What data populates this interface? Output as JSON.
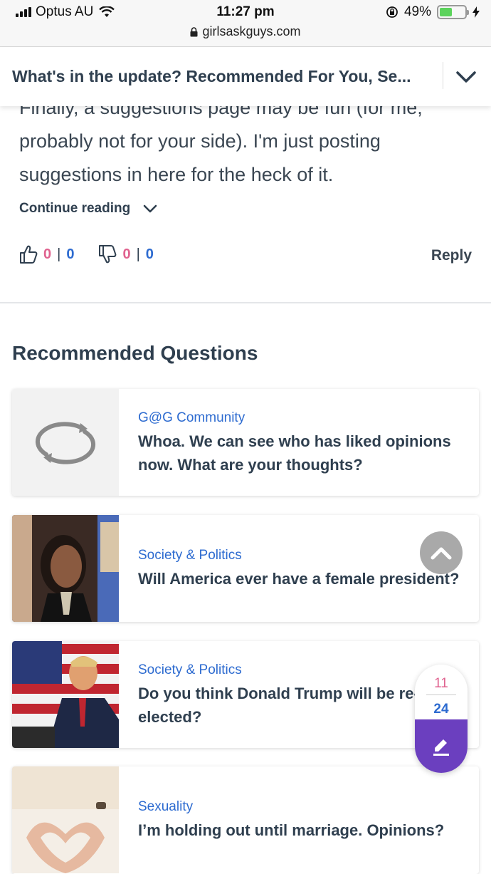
{
  "status_bar": {
    "carrier": "Optus AU",
    "time": "11:27 pm",
    "battery_percent": "49%",
    "battery_level": 0.49,
    "url": "girlsaskguys.com"
  },
  "topic_header": {
    "title": "What's in the update? Recommended For You, Se..."
  },
  "article": {
    "text": "Finally, a suggestions page may be fun (for me, probably not for your side). I'm just posting suggestions in here for the heck of it.",
    "continue_label": "Continue reading",
    "likes": {
      "pink": "0",
      "sep": "|",
      "blue": "0"
    },
    "dislikes": {
      "pink": "0",
      "sep": "|",
      "blue": "0"
    },
    "reply_label": "Reply"
  },
  "recommended": {
    "title": "Recommended Questions",
    "items": [
      {
        "category": "G@G Community",
        "question": "Whoa. We can see who has liked opinions now. What are your thoughts?"
      },
      {
        "category": "Society & Politics",
        "question": "Will America ever have a female president?"
      },
      {
        "category": "Society & Politics",
        "question": "Do you think Donald Trump will be re-elected?"
      },
      {
        "category": "Sexuality",
        "question": "I’m holding out until marriage. Opinions?"
      }
    ]
  },
  "fab": {
    "top": "11",
    "bottom": "24",
    "icon": "pencil-icon"
  },
  "colors": {
    "pink": "#e0628f",
    "blue": "#2d6bd0",
    "purple": "#6b3fbf",
    "text": "#2f3f4f"
  }
}
